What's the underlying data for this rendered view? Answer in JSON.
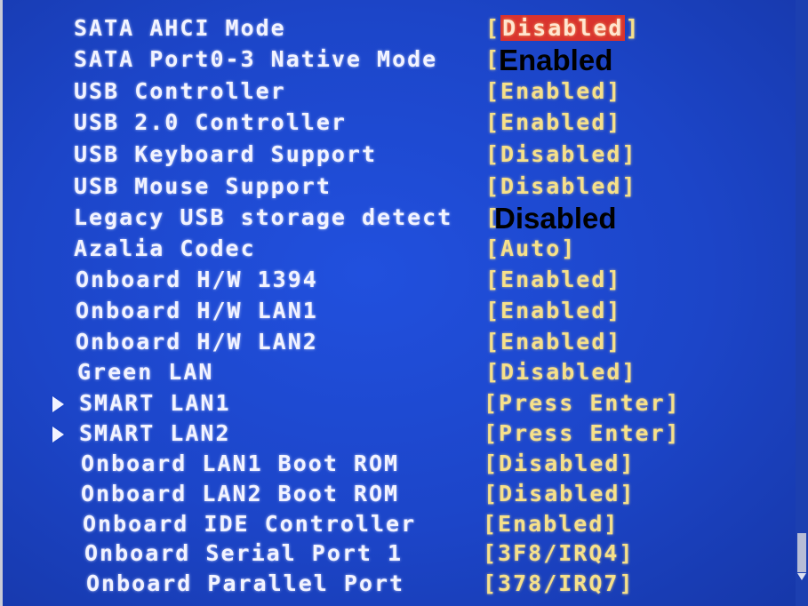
{
  "rows": [
    {
      "label": "SATA AHCI Mode",
      "value": "[Disabled]",
      "highlight": true
    },
    {
      "label": "SATA Port0-3 Native Mode",
      "value": "[",
      "overlay": "Enabled"
    },
    {
      "label": "USB Controller",
      "value": "[Enabled]"
    },
    {
      "label": "USB 2.0 Controller",
      "value": "[Enabled]"
    },
    {
      "label": "USB Keyboard Support",
      "value": "[Disabled]"
    },
    {
      "label": "USB Mouse Support",
      "value": "[Disabled]"
    },
    {
      "label": "Legacy USB storage detect",
      "value": "[",
      "overlay": "Disabled"
    },
    {
      "label": "Azalia Codec",
      "value": "[Auto]"
    },
    {
      "label": "Onboard H/W 1394",
      "value": "[Enabled]"
    },
    {
      "label": "Onboard H/W LAN1",
      "value": "[Enabled]"
    },
    {
      "label": "Onboard H/W LAN2",
      "value": "[Enabled]"
    },
    {
      "label": "Green LAN",
      "value": "[Disabled]"
    },
    {
      "label": "SMART LAN1",
      "value": "[Press Enter]",
      "submenu": true
    },
    {
      "label": "SMART LAN2",
      "value": "[Press Enter]",
      "submenu": true
    },
    {
      "label": "Onboard LAN1 Boot ROM",
      "value": "[Disabled]"
    },
    {
      "label": "Onboard LAN2 Boot ROM",
      "value": "[Disabled]"
    },
    {
      "label": "Onboard IDE Controller",
      "value": "[Enabled]"
    },
    {
      "label": "Onboard Serial Port 1",
      "value": "[3F8/IRQ4]"
    },
    {
      "label": "Onboard Parallel Port",
      "value": "[378/IRQ7]"
    }
  ],
  "colors": {
    "background": "#1c45c8",
    "label": "#f2f3ff",
    "value": "#f6e08a",
    "highlight": "#d9332e"
  }
}
